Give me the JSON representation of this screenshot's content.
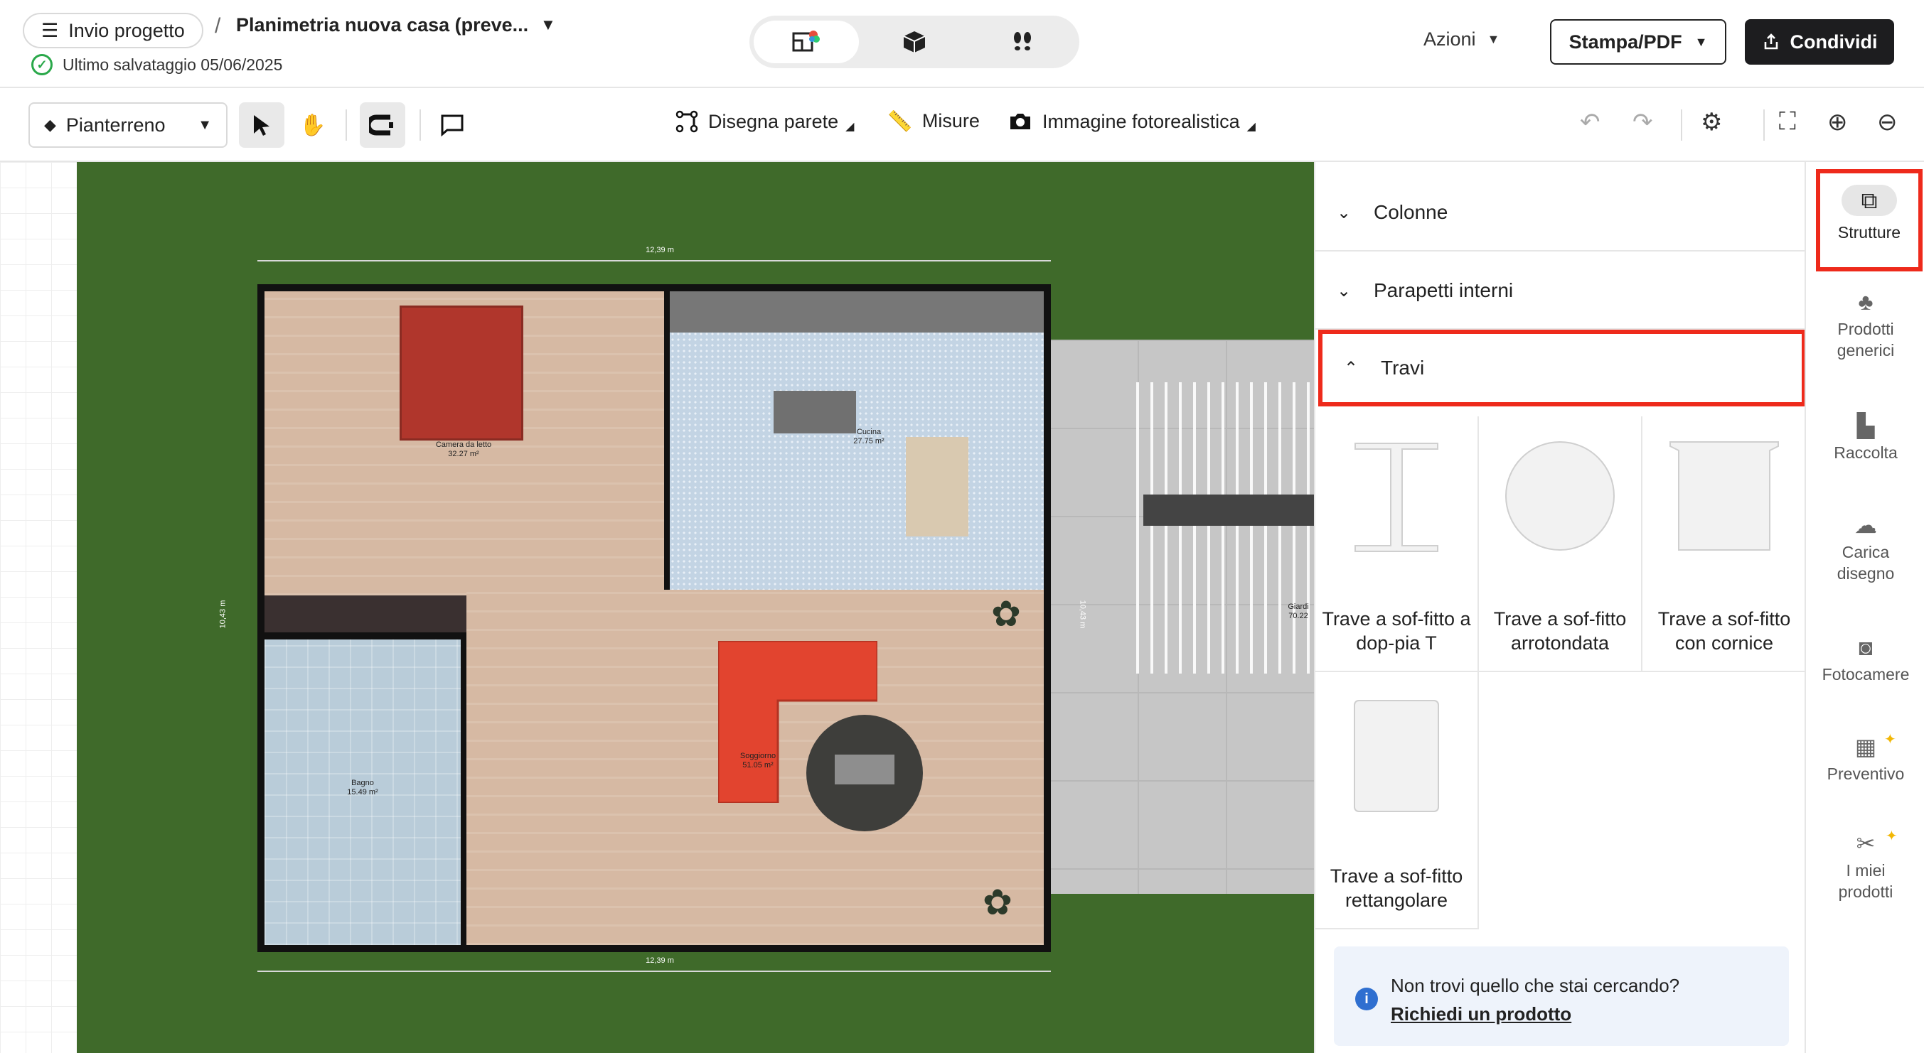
{
  "header": {
    "menu_label": "Invio progetto",
    "separator": "/",
    "project_title": "Planimetria nuova casa (preve...",
    "saved_text": "Ultimo salvataggio 05/06/2025",
    "actions_label": "Azioni",
    "print_label": "Stampa/PDF",
    "share_label": "Condividi"
  },
  "toolbar": {
    "floor": "Pianterreno",
    "draw_wall": "Disegna parete",
    "measures": "Misure",
    "photo": "Immagine fotorealistica"
  },
  "plan": {
    "dim_top": "12,39 m",
    "dim_bottom": "12,39 m",
    "dim_left": "10,43 m",
    "dim_right": "10,43 m",
    "rooms": [
      {
        "name": "Camera da letto",
        "area": "32.27 m²"
      },
      {
        "name": "Cucina",
        "area": "27.75 m²"
      },
      {
        "name": "Soggiorno",
        "area": "51.05 m²"
      },
      {
        "name": "Bagno",
        "area": "15.49 m²"
      },
      {
        "name": "Giardi",
        "area": "70.22"
      }
    ]
  },
  "panel": {
    "sections": [
      "Colonne",
      "Parapetti interni",
      "Travi"
    ],
    "items": [
      {
        "label": "Trave a sof-fitto a dop-pia T",
        "icon": "i-beam-icon"
      },
      {
        "label": "Trave a sof-fitto arrotondata",
        "icon": "round-beam-icon"
      },
      {
        "label": "Trave a sof-fitto con cornice",
        "icon": "cornice-beam-icon"
      },
      {
        "label": "Trave a sof-fitto rettangolare",
        "icon": "rectangular-beam-icon"
      }
    ],
    "notice_text": "Non trovi quello che stai cercando?",
    "notice_link": "Richiedi un prodotto"
  },
  "rail": {
    "items": [
      "Strutture",
      "Prodotti generici",
      "Raccolta",
      "Carica disegno",
      "Fotocamere",
      "Preventivo",
      "I miei prodotti"
    ]
  },
  "colors": {
    "highlight": "#ee2a1b",
    "primary_dark": "#1d1d1f",
    "grass": "#3f6a2a",
    "info_blue": "#2f6fd0"
  }
}
